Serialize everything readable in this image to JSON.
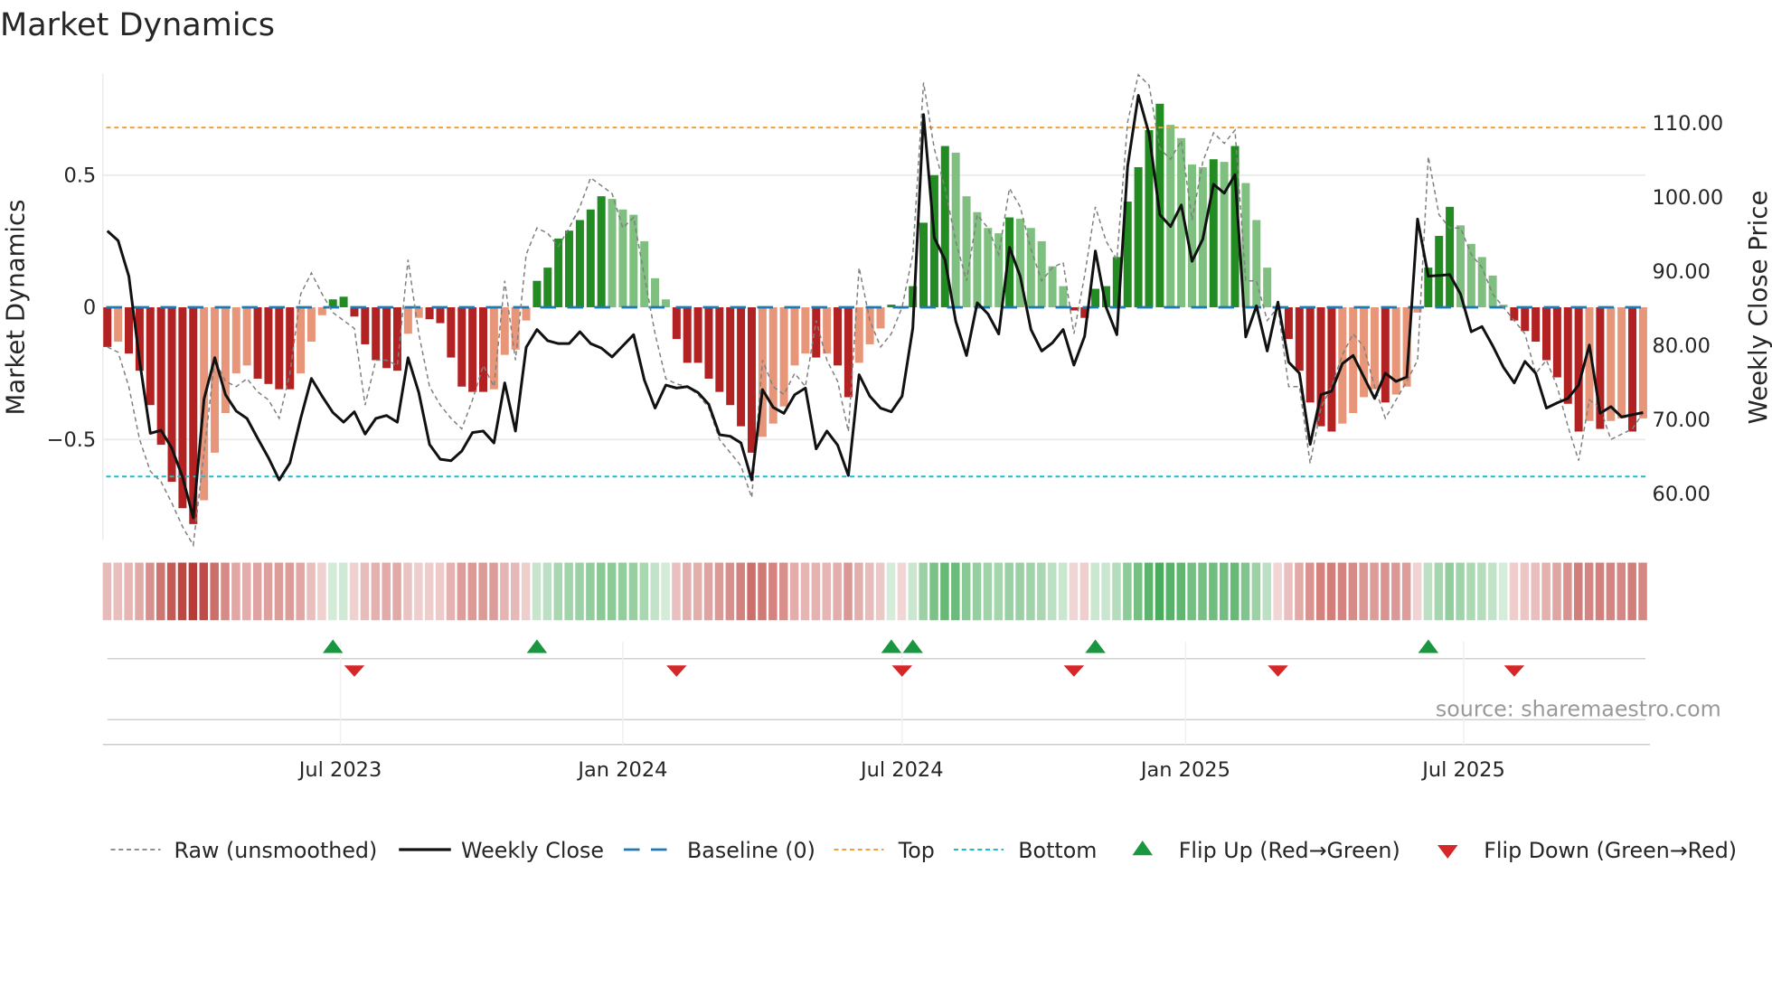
{
  "chart_data": {
    "type": "bar",
    "title": "Market Dynamics",
    "ylabel_left": "Market Dynamics",
    "ylabel_right": "Weekly Close Price",
    "left_ylim": [
      -0.92,
      0.88
    ],
    "right_ylim": [
      54,
      113.7
    ],
    "left_ticks": [
      {
        "v": 0.5,
        "label": "0.5"
      },
      {
        "v": 0,
        "label": "0"
      },
      {
        "v": -0.5,
        "label": "−0.5"
      }
    ],
    "right_ticks": [
      {
        "v": 110,
        "label": "110.00"
      },
      {
        "v": 100,
        "label": "100.00"
      },
      {
        "v": 90,
        "label": "90.00"
      },
      {
        "v": 80,
        "label": "80.00"
      },
      {
        "v": 70,
        "label": "70.00"
      },
      {
        "v": 60,
        "label": "60.00"
      }
    ],
    "x_ticks": [
      {
        "week": 21.7,
        "label": "Jul 2023"
      },
      {
        "week": 48.0,
        "label": "Jan 2024"
      },
      {
        "week": 74.0,
        "label": "Jul 2024"
      },
      {
        "week": 100.4,
        "label": "Jan 2025"
      },
      {
        "week": 126.3,
        "label": "Jul 2025"
      }
    ],
    "top_level": 0.68,
    "bottom_level": -0.64,
    "baseline": 0,
    "dynamics": [
      -0.15,
      -0.13,
      -0.175,
      -0.24,
      -0.37,
      -0.52,
      -0.66,
      -0.76,
      -0.82,
      -0.73,
      -0.55,
      -0.4,
      -0.25,
      -0.22,
      -0.27,
      -0.29,
      -0.31,
      -0.31,
      -0.25,
      -0.13,
      -0.03,
      0.03,
      0.04,
      -0.035,
      -0.14,
      -0.2,
      -0.23,
      -0.24,
      -0.1,
      -0.04,
      -0.045,
      -0.06,
      -0.19,
      -0.3,
      -0.32,
      -0.32,
      -0.31,
      -0.18,
      -0.16,
      -0.05,
      0.1,
      0.15,
      0.26,
      0.29,
      0.33,
      0.37,
      0.42,
      0.41,
      0.37,
      0.35,
      0.25,
      0.11,
      0.03,
      -0.12,
      -0.21,
      -0.21,
      -0.27,
      -0.32,
      -0.37,
      -0.45,
      -0.55,
      -0.49,
      -0.44,
      -0.375,
      -0.22,
      -0.175,
      -0.19,
      -0.175,
      -0.22,
      -0.34,
      -0.21,
      -0.14,
      -0.08,
      0.01,
      -0.005,
      0.08,
      0.32,
      0.5,
      0.61,
      0.585,
      0.42,
      0.36,
      0.3,
      0.28,
      0.34,
      0.335,
      0.3,
      0.25,
      0.155,
      0.08,
      -0.012,
      -0.04,
      0.07,
      0.08,
      0.19,
      0.4,
      0.53,
      0.67,
      0.77,
      0.69,
      0.64,
      0.54,
      0.53,
      0.56,
      0.55,
      0.61,
      0.47,
      0.33,
      0.15,
      -0.005,
      -0.12,
      -0.24,
      -0.36,
      -0.45,
      -0.47,
      -0.44,
      -0.4,
      -0.34,
      -0.31,
      -0.36,
      -0.33,
      -0.3,
      -0.02,
      0.15,
      0.27,
      0.38,
      0.31,
      0.24,
      0.19,
      0.12,
      0.01,
      -0.05,
      -0.09,
      -0.13,
      -0.2,
      -0.265,
      -0.365,
      -0.47,
      -0.43,
      -0.46,
      -0.43,
      -0.42,
      -0.47,
      -0.42
    ],
    "raw": [
      -0.15,
      -0.17,
      -0.3,
      -0.5,
      -0.62,
      -0.66,
      -0.74,
      -0.83,
      -0.9,
      -0.55,
      -0.2,
      -0.28,
      -0.3,
      -0.27,
      -0.32,
      -0.35,
      -0.42,
      -0.25,
      0.05,
      0.13,
      0.05,
      -0.02,
      -0.05,
      -0.08,
      -0.37,
      -0.2,
      -0.2,
      -0.22,
      0.18,
      -0.1,
      -0.3,
      -0.37,
      -0.42,
      -0.46,
      -0.35,
      -0.22,
      -0.3,
      0.1,
      -0.2,
      0.2,
      0.3,
      0.28,
      0.23,
      0.3,
      0.38,
      0.49,
      0.46,
      0.43,
      0.3,
      0.34,
      0.12,
      -0.1,
      -0.27,
      -0.29,
      -0.3,
      -0.33,
      -0.38,
      -0.5,
      -0.55,
      -0.6,
      -0.72,
      -0.2,
      -0.3,
      -0.33,
      -0.25,
      -0.3,
      -0.05,
      -0.2,
      -0.28,
      -0.47,
      0.15,
      -0.05,
      -0.15,
      -0.1,
      0.0,
      0.2,
      0.85,
      0.6,
      0.45,
      0.25,
      0.1,
      0.35,
      0.3,
      0.2,
      0.45,
      0.38,
      0.22,
      0.1,
      0.15,
      0.17,
      -0.1,
      0.12,
      0.38,
      0.25,
      0.18,
      0.7,
      0.88,
      0.84,
      0.6,
      0.56,
      0.63,
      0.33,
      0.55,
      0.66,
      0.62,
      0.67,
      0.1,
      0.1,
      -0.05,
      0.0,
      -0.3,
      -0.3,
      -0.59,
      -0.38,
      -0.3,
      -0.18,
      -0.1,
      -0.15,
      -0.3,
      -0.42,
      -0.35,
      -0.28,
      -0.2,
      0.57,
      0.35,
      0.3,
      0.3,
      0.2,
      0.15,
      0.05,
      0.0,
      -0.05,
      -0.1,
      -0.25,
      -0.2,
      -0.3,
      -0.45,
      -0.58,
      -0.35,
      -0.38,
      -0.5,
      -0.48,
      -0.46,
      -0.4
    ],
    "weekly_close": [
      95.3,
      94.0,
      89.2,
      77.8,
      68.0,
      68.4,
      66.0,
      62.1,
      56.6,
      72.6,
      78.2,
      73.2,
      71.0,
      70.0,
      67.3,
      64.7,
      61.7,
      64.0,
      70.0,
      75.4,
      73.0,
      70.8,
      69.5,
      70.9,
      67.9,
      70.0,
      70.4,
      69.5,
      78.2,
      73.5,
      66.5,
      64.5,
      64.3,
      65.6,
      68.1,
      68.3,
      66.7,
      74.8,
      68.3,
      79.6,
      82.0,
      80.5,
      80.1,
      80.1,
      81.7,
      80.1,
      79.5,
      78.3,
      79.8,
      81.3,
      75.2,
      71.4,
      74.5,
      74.1,
      74.3,
      73.5,
      71.9,
      67.8,
      67.6,
      66.7,
      61.7,
      73.9,
      71.5,
      70.7,
      73.2,
      74.1,
      65.9,
      68.3,
      66.4,
      62.3,
      75.9,
      73.0,
      71.4,
      70.9,
      73.0,
      82.2,
      111.0,
      94.4,
      91.4,
      83.1,
      78.5,
      85.6,
      84.1,
      81.4,
      93.1,
      89.2,
      82.0,
      79.1,
      80.2,
      82.0,
      77.2,
      81.1,
      92.6,
      85.0,
      81.3,
      104.0,
      113.6,
      108.4,
      97.5,
      95.9,
      98.8,
      91.2,
      94.2,
      101.6,
      100.4,
      102.9,
      81.0,
      85.2,
      79.1,
      85.7,
      77.6,
      76.1,
      66.5,
      73.2,
      73.7,
      77.4,
      78.5,
      75.6,
      72.7,
      76.1,
      75.0,
      75.6,
      96.9,
      89.2,
      89.3,
      89.4,
      86.8,
      81.7,
      82.4,
      79.8,
      76.9,
      74.8,
      77.7,
      76.1,
      71.4,
      72.1,
      72.7,
      74.5,
      79.9,
      70.7,
      71.6,
      70.2,
      70.5,
      70.8
    ],
    "flip_up_weeks": [
      21,
      40,
      73,
      75,
      92,
      123
    ],
    "flip_down_weeks": [
      23,
      53,
      74,
      90,
      109,
      131
    ],
    "colors": {
      "strong_red": "#b22222",
      "weak_red": "#e8967a",
      "strong_green": "#228b22",
      "weak_green": "#7fbf7f",
      "raw": "#808080",
      "close": "#111111",
      "baseline": "#1f77b4",
      "top": "#f0a040",
      "bottom": "#17becf",
      "flip_up": "#1a9641",
      "flip_down": "#d62728"
    },
    "legend": [
      "Raw (unsmoothed)",
      "Weekly Close",
      "Baseline (0)",
      "Top",
      "Bottom",
      "Flip Up (Red→Green)",
      "Flip Down (Green→Red)"
    ],
    "legend_position": "bottom",
    "source": "source: sharemaestro.com"
  }
}
